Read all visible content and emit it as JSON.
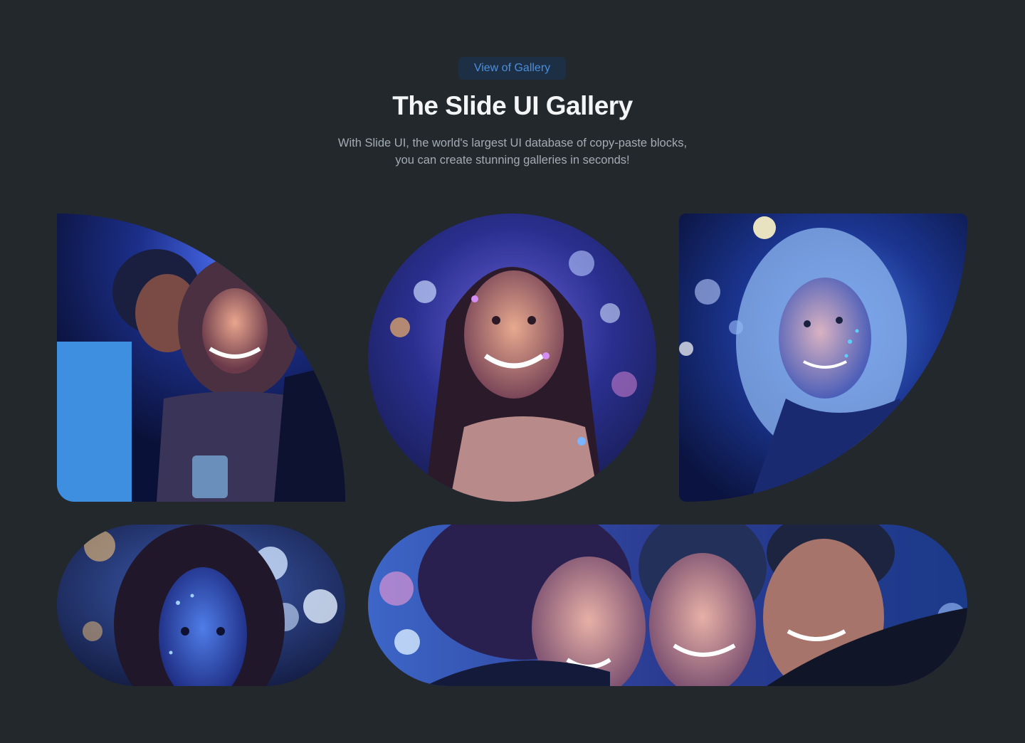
{
  "header": {
    "badge_label": "View of Gallery",
    "title": "The Slide UI Gallery",
    "subtitle_line1": "With Slide UI, the world's largest UI database of copy-paste blocks,",
    "subtitle_line2": "you can create stunning galleries in seconds!"
  },
  "gallery": {
    "images": [
      {
        "icon": "photo-group-friends-party",
        "shape": "quarter-leaf"
      },
      {
        "icon": "photo-smiling-woman-paint",
        "shape": "circle"
      },
      {
        "icon": "photo-woman-glowing-face",
        "shape": "leaf"
      },
      {
        "icon": "photo-woman-face-paint",
        "shape": "pill"
      },
      {
        "icon": "photo-three-friends-laughing",
        "shape": "pill-wide"
      }
    ]
  },
  "colors": {
    "background": "#22282c",
    "accent": "#4b8fdc",
    "badge_background": "#1d2f45",
    "title": "#f3f5f7",
    "subtitle": "#a4abb3"
  }
}
